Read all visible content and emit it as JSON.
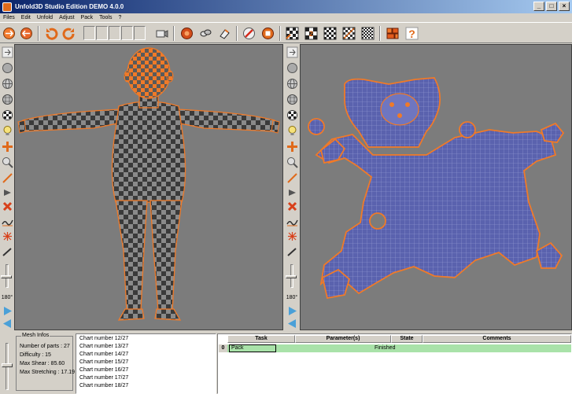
{
  "window": {
    "title": "Unfold3D Studio Edition DEMO 4.0.0"
  },
  "menu": [
    "Files",
    "Edit",
    "Unfold",
    "Adjust",
    "Pack",
    "Tools",
    "?"
  ],
  "left_panel": {
    "angle": "180°"
  },
  "right_panel": {
    "angle": "180°"
  },
  "mesh_infos": {
    "legend": "Mesh Infos",
    "parts": "Number of parts : 27",
    "difficulty": "Difficulty    : 15",
    "max_shear": "Max Shear    : 85.60",
    "max_stretching": "Max Stretching : 17.19"
  },
  "chart_log": [
    "Chart number 12/27",
    "Chart number 13/27",
    "Chart number 14/27",
    "Chart number 15/27",
    "Chart number 16/27",
    "Chart number 17/27",
    "Chart number 18/27"
  ],
  "task_table": {
    "headers": {
      "task": "Task",
      "parameters": "Parameter(s)",
      "state": "State",
      "comments": "Comments"
    },
    "row": {
      "index": "0",
      "task": "Pack",
      "parameters": "",
      "state": "Finished",
      "comments": ""
    }
  },
  "colors": {
    "accent_orange": "#f0781e",
    "uv_blue": "#4f58a6",
    "viewport_gray": "#7c7c7c",
    "task_row_green": "#a9e2a9"
  }
}
